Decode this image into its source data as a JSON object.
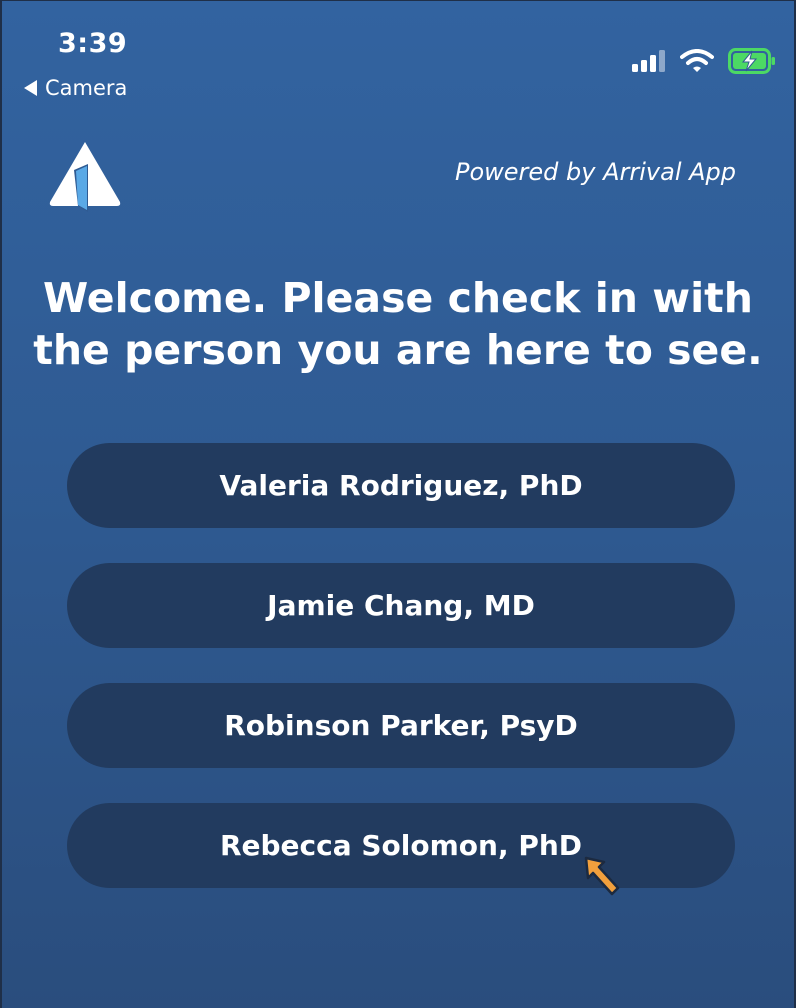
{
  "status_bar": {
    "time": "3:39",
    "back_label": "Camera",
    "icons": [
      "cellular-signal-icon",
      "wifi-icon",
      "battery-charging-icon"
    ],
    "battery_color": "#4cd964"
  },
  "header": {
    "logo": "arrival-app-logo",
    "powered_by": "Powered by Arrival App"
  },
  "welcome": {
    "line1": "Welcome.  Please check in with",
    "line2": "the person you are here to see."
  },
  "providers": [
    {
      "label": "Valeria Rodriguez, PhD"
    },
    {
      "label": "Jamie Chang, MD"
    },
    {
      "label": "Robinson Parker, PsyD"
    },
    {
      "label": "Rebecca Solomon, PhD"
    }
  ],
  "colors": {
    "background_top": "#3263a0",
    "background_bottom": "#2a4d7d",
    "button": "#223b5f",
    "pointer_annotation": "#f2a03d"
  },
  "annotation": {
    "icon": "pointer-arrow-icon"
  }
}
